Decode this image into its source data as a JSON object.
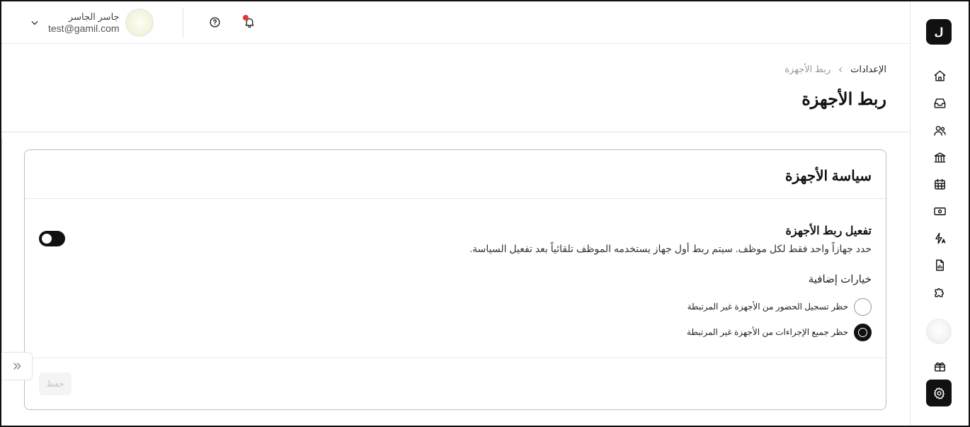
{
  "rail": {
    "logo_text": "ل",
    "items": [
      {
        "name": "home",
        "icon": "home-icon"
      },
      {
        "name": "inbox",
        "icon": "inbox-icon"
      },
      {
        "name": "employees",
        "icon": "users-icon"
      },
      {
        "name": "bank",
        "icon": "bank-icon"
      },
      {
        "name": "calendar",
        "icon": "calendar-icon"
      },
      {
        "name": "payroll",
        "icon": "money-icon"
      },
      {
        "name": "automation",
        "icon": "lightning-a-icon"
      },
      {
        "name": "reports",
        "icon": "file-chart-icon"
      },
      {
        "name": "integrations",
        "icon": "puzzle-icon"
      },
      {
        "name": "gifts",
        "icon": "gift-icon"
      },
      {
        "name": "settings",
        "icon": "gear-icon",
        "active": true
      }
    ]
  },
  "header": {
    "user_name": "جاسر الجاسر",
    "user_email": "test@gamil.com",
    "notification_dot_color": "#e53935"
  },
  "page": {
    "breadcrumb_root": "الإعدادات",
    "breadcrumb_current": "ربط الأجهزة",
    "title": "ربط الأجهزة"
  },
  "card": {
    "title": "سياسة الأجهزة",
    "toggle_title": "تفعيل ربط الأجهزة",
    "toggle_description": "حدد جهازاً واحد فقط لكل موظف. سيتم ربط أول جهاز يستخدمه الموظف تلقائياً بعد تفعيل السياسة.",
    "toggle_on": false,
    "extra_options_label": "خيارات إضافية",
    "options": [
      {
        "label": "حظر تسجيل الحضور من الأجهزة غير المرتبطة",
        "selected": false
      },
      {
        "label": "حظر جميع الإجراءات من الأجهزة غير المرتبطة",
        "selected": true
      }
    ],
    "save_label": "حفظ"
  }
}
